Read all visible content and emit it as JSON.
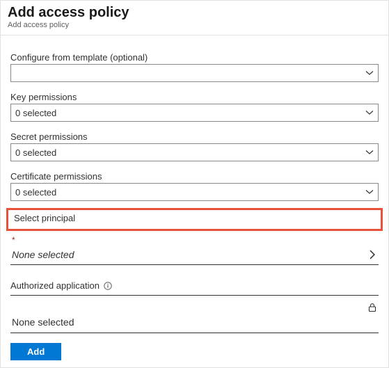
{
  "header": {
    "title": "Add access policy",
    "subtitle": "Add access policy"
  },
  "fields": {
    "template": {
      "label": "Configure from template (optional)",
      "value": ""
    },
    "key": {
      "label": "Key permissions",
      "value": "0 selected"
    },
    "secret": {
      "label": "Secret permissions",
      "value": "0 selected"
    },
    "cert": {
      "label": "Certificate permissions",
      "value": "0 selected"
    }
  },
  "principal": {
    "section_label": "Select principal",
    "required_marker": "*",
    "value": "None selected"
  },
  "authorized_app": {
    "label": "Authorized application",
    "value": "None selected"
  },
  "buttons": {
    "add": "Add"
  }
}
